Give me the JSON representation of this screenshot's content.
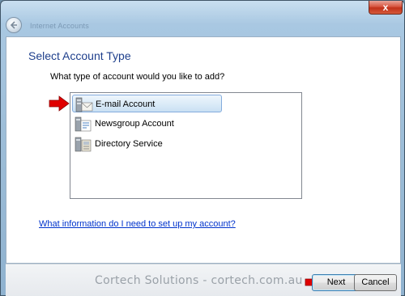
{
  "window": {
    "title": "Internet Accounts"
  },
  "page": {
    "heading": "Select Account Type",
    "question": "What type of account would you like to add?",
    "help_link": "What information do I need to set up my account?",
    "watermark": "Cortech Solutions - cortech.com.au"
  },
  "account_types": [
    {
      "label": "E-mail Account",
      "icon": "email-account-icon",
      "selected": true
    },
    {
      "label": "Newsgroup Account",
      "icon": "newsgroup-account-icon",
      "selected": false
    },
    {
      "label": "Directory Service",
      "icon": "directory-service-icon",
      "selected": false
    }
  ],
  "buttons": {
    "next": "Next",
    "cancel": "Cancel",
    "close": "x"
  },
  "colors": {
    "heading": "#1e3f8c",
    "link": "#0033cc",
    "annotation_arrow": "#e00000",
    "selection": "#dcecf8"
  }
}
